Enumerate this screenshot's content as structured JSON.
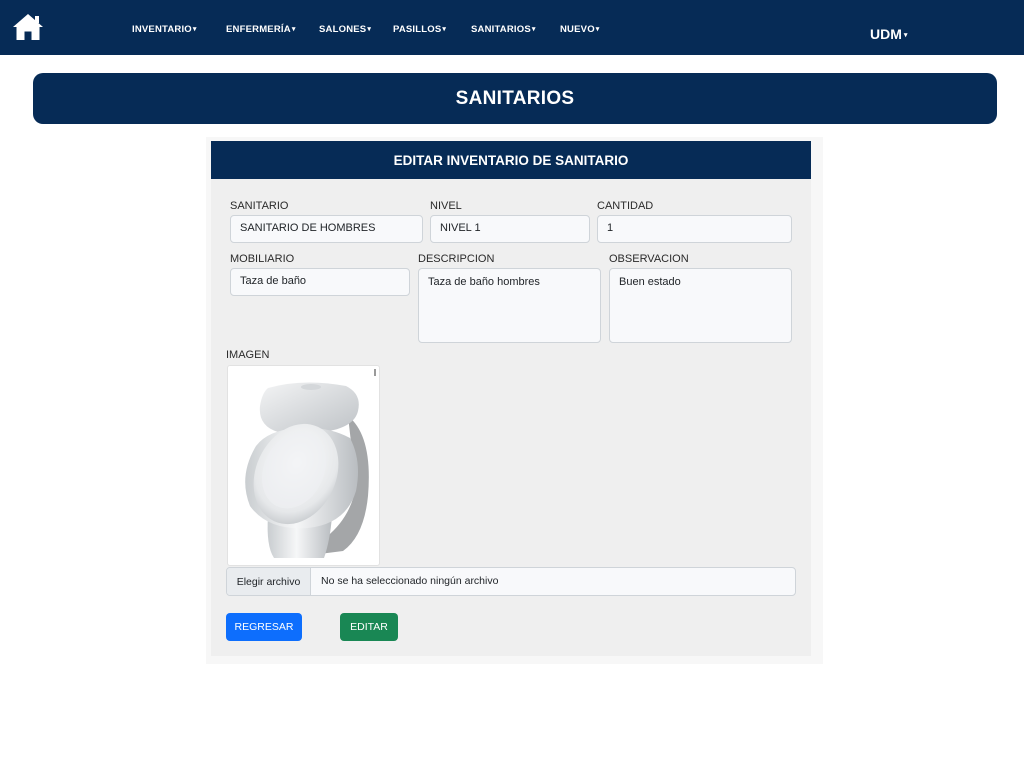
{
  "nav": {
    "home_icon": "home-icon",
    "items": [
      {
        "label": "INVENTARIO"
      },
      {
        "label": "ENFERMERÍA"
      },
      {
        "label": "SALONES"
      },
      {
        "label": "PASILLOS"
      },
      {
        "label": "SANITARIOS"
      },
      {
        "label": "NUEVO"
      }
    ],
    "caret": "▾",
    "user_label": "UDM"
  },
  "banner": {
    "title": "SANITARIOS"
  },
  "form": {
    "header": "EDITAR INVENTARIO DE SANITARIO",
    "sanitario": {
      "label": "SANITARIO",
      "value": "SANITARIO DE HOMBRES"
    },
    "nivel": {
      "label": "NIVEL",
      "value": "NIVEL 1"
    },
    "cantidad": {
      "label": "CANTIDAD",
      "value": "1"
    },
    "mobiliario": {
      "label": "MOBILIARIO",
      "value": "Taza de baño"
    },
    "descripcion": {
      "label": "DESCRIPCION",
      "value": "Taza de baño hombres"
    },
    "observacion": {
      "label": "OBSERVACION",
      "value": "Buen estado"
    },
    "imagen": {
      "label": "IMAGEN"
    },
    "file": {
      "button": "Elegir archivo",
      "status": "No se ha seleccionado ningún archivo"
    },
    "buttons": {
      "back": "REGRESAR",
      "edit": "EDITAR"
    }
  },
  "colors": {
    "navy": "#062b56",
    "primary_button": "#0d6efd",
    "success_button": "#198754",
    "form_background": "#efefef"
  }
}
